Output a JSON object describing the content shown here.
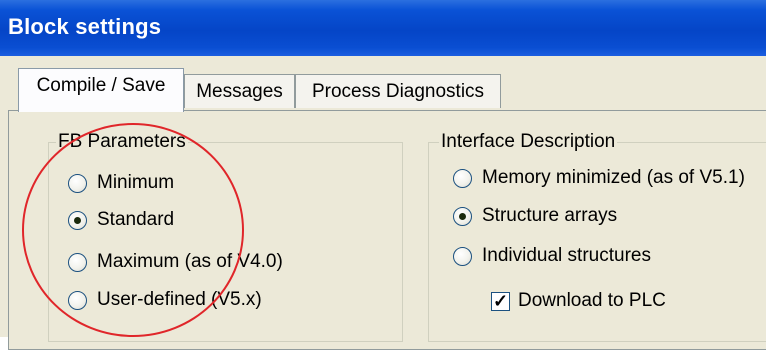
{
  "window": {
    "title": "Block settings"
  },
  "tabs": [
    {
      "label": "Compile / Save",
      "active": true
    },
    {
      "label": "Messages",
      "active": false
    },
    {
      "label": "Process Diagnostics",
      "active": false
    }
  ],
  "fb_parameters": {
    "title": "FB Parameters",
    "options": [
      {
        "label": "Minimum",
        "selected": false
      },
      {
        "label": "Standard",
        "selected": true
      },
      {
        "label": "Maximum (as of V4.0)",
        "selected": false
      },
      {
        "label": "User-defined (V5.x)",
        "selected": false
      }
    ]
  },
  "interface_description": {
    "title": "Interface Description",
    "options": [
      {
        "label": "Memory minimized (as of V5.1)",
        "selected": false
      },
      {
        "label": "Structure arrays",
        "selected": true
      },
      {
        "label": "Individual structures",
        "selected": false
      }
    ],
    "download_to_plc": {
      "label": "Download to PLC",
      "checked": true
    }
  },
  "annotation": {
    "color": "#e0262a"
  }
}
